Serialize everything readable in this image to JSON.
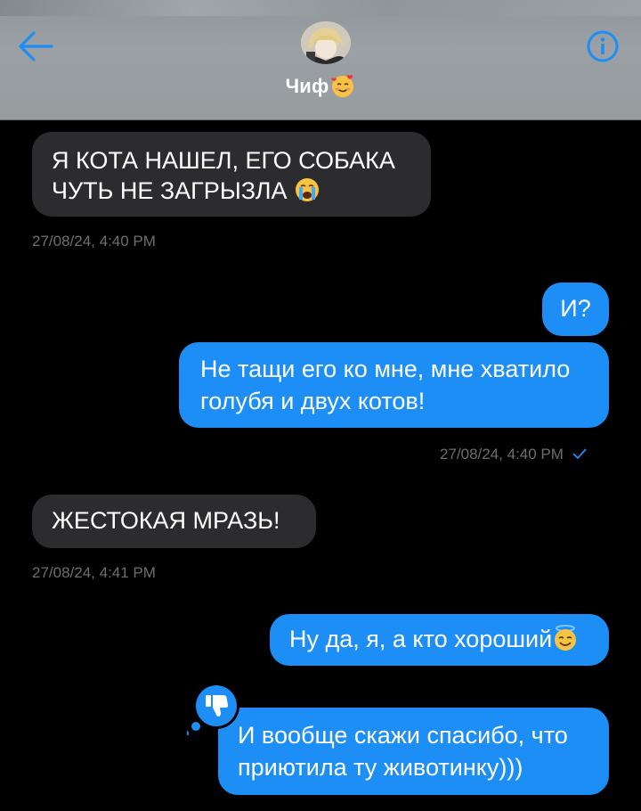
{
  "contact": {
    "name": "Чиф"
  },
  "messages": [
    {
      "id": "m1",
      "direction": "incoming",
      "lines": [
        "Я КОТА НАШЕЛ, ЕГО СОБАКА",
        "ЧУТЬ НЕ ЗАГРЫЗЛА"
      ],
      "emoji": "crying-face",
      "timestamp": "27/08/24, 4:40 PM"
    },
    {
      "id": "m2",
      "direction": "outgoing",
      "text": "И?"
    },
    {
      "id": "m3",
      "direction": "outgoing",
      "lines": [
        "Не тащи его ко мне, мне хватило",
        "голубя и двух котов!"
      ],
      "timestamp": "27/08/24, 4:40 PM",
      "status": "sent-check"
    },
    {
      "id": "m4",
      "direction": "incoming",
      "text": "ЖЕСТОКАЯ МРАЗЬ!",
      "timestamp": "27/08/24, 4:41 PM"
    },
    {
      "id": "m5",
      "direction": "outgoing",
      "text": "Ну да, я, а кто хороший",
      "emoji": "smiling-face-with-halo"
    },
    {
      "id": "m6",
      "direction": "outgoing",
      "lines": [
        "И вообще скажи спасибо, что",
        "приютила ту животинку)))"
      ],
      "reaction": "thumbs-down"
    }
  ],
  "colors": {
    "incoming": "#2c2c2e",
    "outgoing": "#1d8ef5",
    "accent": "#1d8ef5"
  }
}
